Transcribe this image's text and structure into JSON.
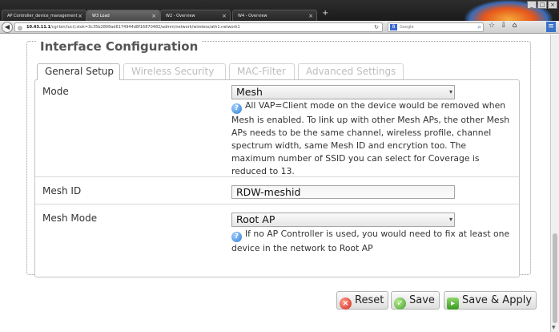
{
  "browser": {
    "tabs": [
      {
        "title": "AP Controller_device_management",
        "active": false
      },
      {
        "title": "W3 Load",
        "active": true
      },
      {
        "title": "W2 - Overview",
        "active": false
      },
      {
        "title": "W4 - Overview",
        "active": false
      }
    ],
    "new_tab_glyph": "+",
    "url_host": "10.43.11.1",
    "url_path": "/cgi-bin/luci/;stok=3c35b2808ad6174944d8f16870482/admin/network/wireless/ath1.network1",
    "search_placeholder": "Google",
    "window_controls": [
      "_",
      "□",
      "×"
    ],
    "firefox_menu_glyph": "≡"
  },
  "section": {
    "title": "Interface Configuration",
    "tabs": [
      "General Setup",
      "Wireless Security",
      "MAC-Filter",
      "Advanced Settings"
    ],
    "active_tab": "General Setup"
  },
  "form": {
    "mode": {
      "label": "Mode",
      "value": "Mesh",
      "help": "All VAP=Client mode on the device would be removed when Mesh is enabled. To link up with other Mesh APs, the other Mesh APs needs to be the same channel, wireless profile, channel spectrum width, same Mesh ID and encrytion too. The maximum number of SSID you can select for Coverage is reduced to 13."
    },
    "mesh_id": {
      "label": "Mesh ID",
      "value": "RDW-meshid"
    },
    "mesh_mode": {
      "label": "Mesh Mode",
      "value": "Root AP",
      "help": "If no AP Controller is used, you would need to fix at least one device in the network to Root AP"
    }
  },
  "actions": {
    "reset": "Reset",
    "save": "Save",
    "save_apply": "Save & Apply"
  },
  "icons": {
    "info": "info-icon",
    "reset": "reset-icon",
    "save": "save-icon",
    "apply": "apply-icon"
  }
}
